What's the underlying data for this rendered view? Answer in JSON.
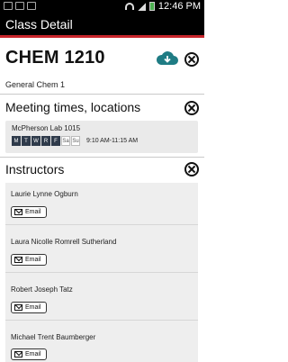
{
  "status_bar": {
    "time": "12:46 PM"
  },
  "app_bar": {
    "title": "Class Detail"
  },
  "course": {
    "code": "CHEM 1210",
    "name": "General Chem 1"
  },
  "meetings": {
    "title": "Meeting times, locations",
    "items": [
      {
        "location": "McPherson Lab 1015",
        "days": [
          {
            "label": "M",
            "active": true
          },
          {
            "label": "T",
            "active": true
          },
          {
            "label": "W",
            "active": true
          },
          {
            "label": "R",
            "active": true
          },
          {
            "label": "F",
            "active": true
          },
          {
            "label": "Sa",
            "active": false
          },
          {
            "label": "Su",
            "active": false
          }
        ],
        "time": "9:10 AM-11:15 AM"
      }
    ]
  },
  "instructors": {
    "title": "Instructors",
    "email_label": "Email",
    "items": [
      {
        "name": "Laurie Lynne Ogburn"
      },
      {
        "name": "Laura Nicolle Romrell Sutherland"
      },
      {
        "name": "Robert Joseph Tatz"
      },
      {
        "name": "Michael Trent Baumberger"
      }
    ]
  },
  "colors": {
    "accent_red": "#c8262b",
    "cloud_teal": "#1f7c84",
    "day_active": "#2f3b4b"
  },
  "icons": {
    "download": "cloud-download-icon",
    "close": "close-circle-icon",
    "email": "envelope-icon"
  }
}
